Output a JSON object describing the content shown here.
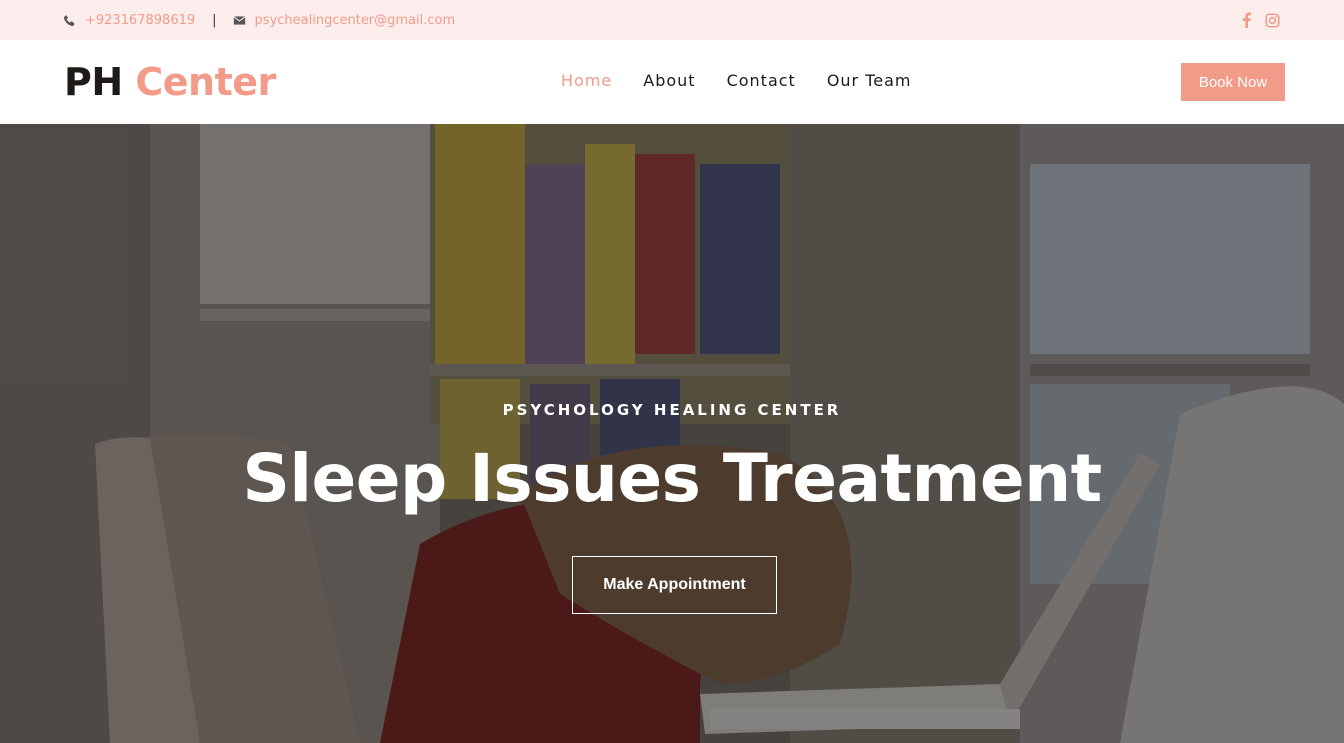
{
  "topbar": {
    "phone": "+923167898619",
    "separator": "|",
    "email": "psychealingcenter@gmail.com",
    "icons": [
      "phone-icon",
      "envelope-icon",
      "facebook-icon",
      "instagram-icon"
    ]
  },
  "header": {
    "logo_part1": "PH",
    "logo_part2": "Center",
    "nav": {
      "home": "Home",
      "about": "About",
      "contact": "Contact",
      "team": "Our Team"
    },
    "active_nav": "Home",
    "book_label": "Book Now"
  },
  "hero": {
    "eyebrow": "PSYCHOLOGY HEALING CENTER",
    "title": "Sleep Issues Treatment",
    "cta_label": "Make Appointment"
  },
  "colors": {
    "accent": "#f29b89",
    "topbar_bg": "#fdeeed",
    "text_dark": "#1f1a17"
  }
}
